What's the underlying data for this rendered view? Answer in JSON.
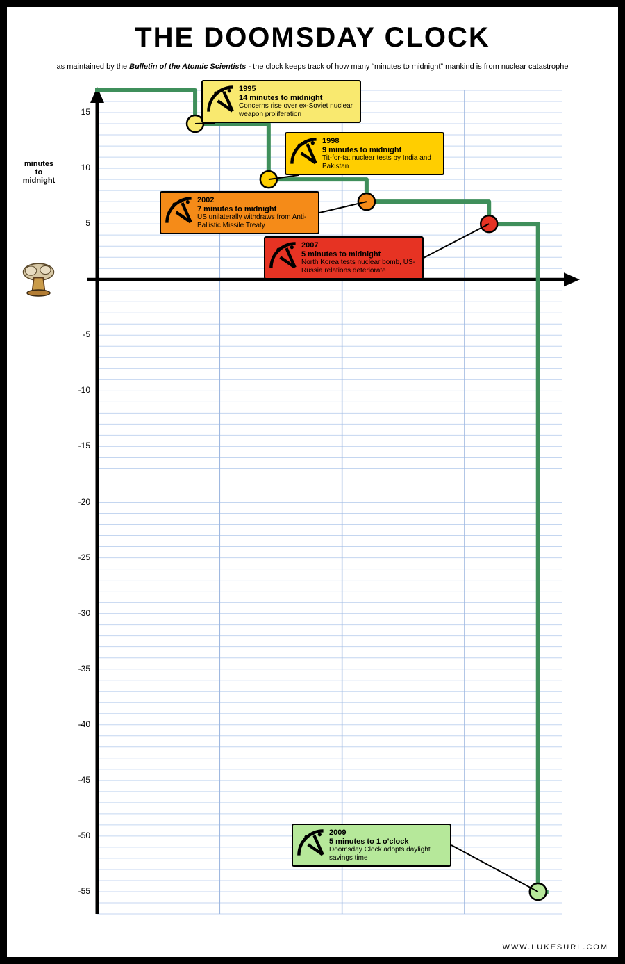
{
  "title": "THE DOOMSDAY CLOCK",
  "subtitle_prefix": "as maintained by the ",
  "subtitle_em": "Bulletin of the Atomic Scientists",
  "subtitle_suffix": " - the clock keeps track of how many “minutes to midnight” mankind is from nuclear catastrophe",
  "ylabel": "minutes\nto\nmidnight",
  "footer": "WWW.LUKESURL.COM",
  "callouts": [
    {
      "year": "1995",
      "minutes_line": "14 minutes to midnight",
      "desc": "Concerns rise over ex-Soviet nuclear weapon proliferation",
      "color": "#f9e96f"
    },
    {
      "year": "1998",
      "minutes_line": "9 minutes to midnight",
      "desc": "Tit-for-tat nuclear tests by India and Pakistan",
      "color": "#ffce00"
    },
    {
      "year": "2002",
      "minutes_line": "7 minutes to midnight",
      "desc": "US unilaterally withdraws from Anti-Ballistic Missile Treaty",
      "color": "#f58b18"
    },
    {
      "year": "2007",
      "minutes_line": "5 minutes to midnight",
      "desc": "North Korea tests nuclear bomb, US-Russia relations deteriorate",
      "color": "#e63323"
    },
    {
      "year": "2009",
      "minutes_line": "5 minutes to 1 o'clock",
      "desc": "Doomsday Clock adopts daylight savings time",
      "color": "#b6e89a"
    }
  ],
  "chart_data": {
    "type": "line",
    "step_mode": "hv",
    "xlabel": "",
    "ylabel": "minutes to midnight",
    "ylim": [
      -57,
      17
    ],
    "y_ticks": [
      15,
      10,
      5,
      -5,
      -10,
      -15,
      -20,
      -25,
      -30,
      -35,
      -40,
      -45,
      -50,
      -55
    ],
    "x_baseline_y": 0,
    "start": {
      "year": 1991,
      "minutes": 17
    },
    "points": [
      {
        "year": 1995,
        "minutes": 14,
        "fill": "#f9e96f"
      },
      {
        "year": 1998,
        "minutes": 9,
        "fill": "#ffce00"
      },
      {
        "year": 2002,
        "minutes": 7,
        "fill": "#f58b18"
      },
      {
        "year": 2007,
        "minutes": 5,
        "fill": "#e63323"
      },
      {
        "year": 2009,
        "minutes": -55,
        "fill": "#b6e89a"
      }
    ],
    "title": "THE DOOMSDAY CLOCK"
  }
}
